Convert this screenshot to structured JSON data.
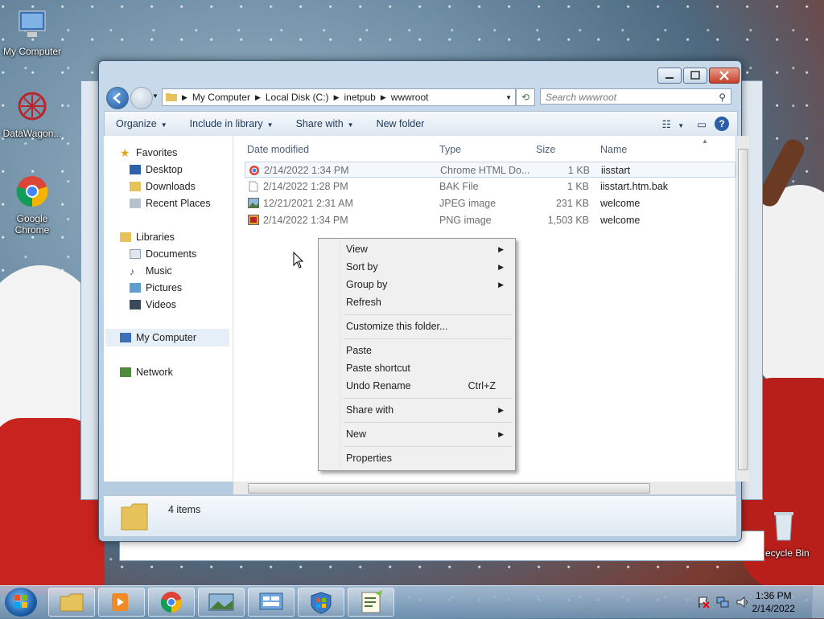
{
  "desktop": {
    "icons": [
      {
        "label": "My Computer"
      },
      {
        "label": "DataWagon..."
      },
      {
        "label": "Google Chrome"
      },
      {
        "label": "Recycle Bin"
      }
    ]
  },
  "window": {
    "breadcrumb": [
      "My Computer",
      "Local Disk (C:)",
      "inetpub",
      "wwwroot"
    ],
    "search_placeholder": "Search wwwroot",
    "toolbar": {
      "organize": "Organize",
      "include": "Include in library",
      "share": "Share with",
      "new_folder": "New folder"
    },
    "nav": {
      "favorites": "Favorites",
      "desktop": "Desktop",
      "downloads": "Downloads",
      "recent": "Recent Places",
      "libraries": "Libraries",
      "documents": "Documents",
      "music": "Music",
      "pictures": "Pictures",
      "videos": "Videos",
      "computer": "My Computer",
      "network": "Network"
    },
    "columns": {
      "date": "Date modified",
      "type": "Type",
      "size": "Size",
      "name": "Name"
    },
    "files": [
      {
        "date": "2/14/2022 1:34 PM",
        "type": "Chrome HTML Do...",
        "size": "1 KB",
        "name": "iisstart"
      },
      {
        "date": "2/14/2022 1:28 PM",
        "type": "BAK File",
        "size": "1 KB",
        "name": "iisstart.htm.bak"
      },
      {
        "date": "12/21/2021 2:31 AM",
        "type": "JPEG image",
        "size": "231 KB",
        "name": "welcome"
      },
      {
        "date": "2/14/2022 1:34 PM",
        "type": "PNG image",
        "size": "1,503 KB",
        "name": "welcome"
      }
    ],
    "status": "4 items"
  },
  "context_menu": {
    "view": "View",
    "sort_by": "Sort by",
    "group_by": "Group by",
    "refresh": "Refresh",
    "customize": "Customize this folder...",
    "paste": "Paste",
    "paste_shortcut": "Paste shortcut",
    "undo_rename": "Undo Rename",
    "undo_shortcut": "Ctrl+Z",
    "share_with": "Share with",
    "new": "New",
    "properties": "Properties"
  },
  "taskbar": {
    "time": "1:36 PM",
    "date": "2/14/2022"
  },
  "colors": {
    "accent": "#1d5fa8",
    "selection": "#c3d6ea"
  }
}
